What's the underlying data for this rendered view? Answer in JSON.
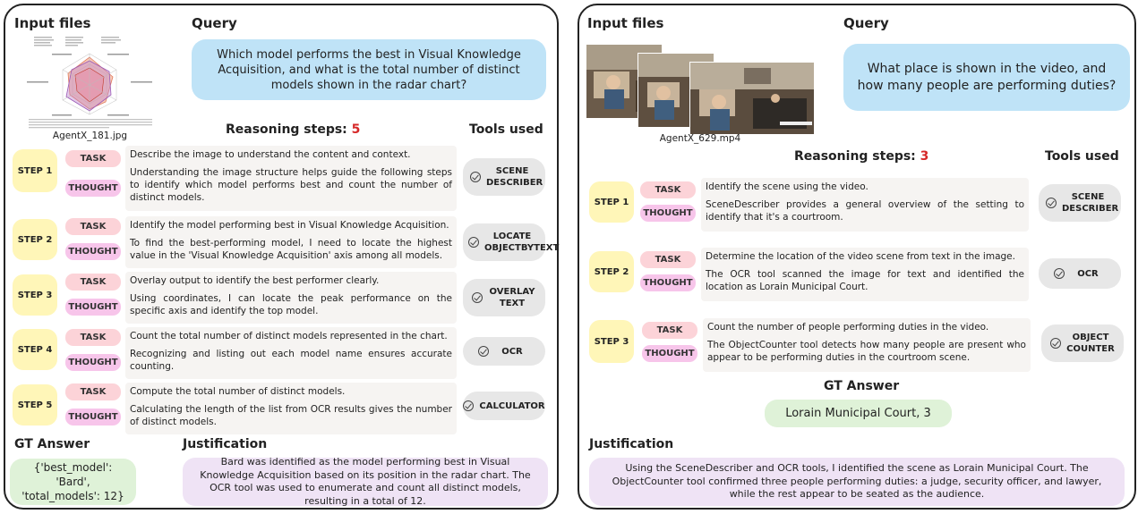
{
  "left": {
    "input_files_header": "Input files",
    "query_header": "Query",
    "query_text": "Which model performs the best in Visual Knowledge Acquisition, and what is the total number of distinct models shown in the radar chart?",
    "file_caption": "AgentX_181.jpg",
    "reasoning_label": "Reasoning steps:",
    "reasoning_count": "5",
    "tools_header": "Tools used",
    "steps": [
      {
        "badge": "STEP 1",
        "task_label": "TASK",
        "thought_label": "THOUGHT",
        "task": "Describe the image to understand the content and context.",
        "thought": "Understanding the image structure helps guide the following steps to identify which model performs best and count the number of distinct models.",
        "tool": "SCENE DESCRIBER"
      },
      {
        "badge": "STEP 2",
        "task_label": "TASK",
        "thought_label": "THOUGHT",
        "task": "Identify the model performing best in Visual Knowledge Acquisition.",
        "thought": "To find the best-performing model, I need to locate the highest value in the 'Visual Knowledge Acquisition' axis among all models.",
        "tool": "LOCATE OBJECTBYTEXT"
      },
      {
        "badge": "STEP 3",
        "task_label": "TASK",
        "thought_label": "THOUGHT",
        "task": "Overlay output to identify the best performer clearly.",
        "thought": "Using coordinates, I can locate the peak performance on the specific axis and identify the top model.",
        "tool": "OVERLAY TEXT"
      },
      {
        "badge": "STEP 4",
        "task_label": "TASK",
        "thought_label": "THOUGHT",
        "task": "Count the total number of distinct models represented in the chart.",
        "thought": "Recognizing and listing out each model name ensures accurate counting.",
        "tool": "OCR"
      },
      {
        "badge": "STEP 5",
        "task_label": "TASK",
        "thought_label": "THOUGHT",
        "task": "Compute the total number of distinct models.",
        "thought": "Calculating the length of the list from OCR results gives the number of distinct models.",
        "tool": "CALCULATOR"
      }
    ],
    "gt_header": "GT Answer",
    "gt_text": "{'best_model': 'Bard', 'total_models': 12}",
    "justification_header": "Justification",
    "justification_text": "Bard was identified as the model performing best in Visual Knowledge Acquisition based on its position in the radar chart. The OCR tool was used to enumerate and count all distinct models, resulting in a total of 12."
  },
  "right": {
    "input_files_header": "Input files",
    "query_header": "Query",
    "query_text": "What place is shown in the video, and how many people are performing duties?",
    "file_caption": "AgentX_629.mp4",
    "reasoning_label": "Reasoning steps:",
    "reasoning_count": "3",
    "tools_header": "Tools used",
    "steps": [
      {
        "badge": "STEP 1",
        "task_label": "TASK",
        "thought_label": "THOUGHT",
        "task": "Identify the scene using the video.",
        "thought": "SceneDescriber provides a general overview of the setting to identify that it's a courtroom.",
        "tool": "SCENE DESCRIBER"
      },
      {
        "badge": "STEP 2",
        "task_label": "TASK",
        "thought_label": "THOUGHT",
        "task": "Determine the location of the video scene from text in the image.",
        "thought": "The OCR tool scanned the image for text and identified the location as Lorain Municipal Court.",
        "tool": "OCR"
      },
      {
        "badge": "STEP 3",
        "task_label": "TASK",
        "thought_label": "THOUGHT",
        "task": "Count the number of people performing duties in the video.",
        "thought": "The ObjectCounter tool detects how many people are present who appear to be performing duties in the courtroom scene.",
        "tool": "OBJECT COUNTER"
      }
    ],
    "gt_header": "GT Answer",
    "gt_text": "Lorain Municipal Court, 3",
    "justification_header": "Justification",
    "justification_text": "Using the SceneDescriber and OCR tools, I identified the scene as Lorain Municipal Court. The ObjectCounter tool confirmed three people performing duties: a judge, security officer, and lawyer, while the rest appear to be seated as the audience."
  },
  "colors": {
    "query_bg": "#bfe3f7",
    "step_badge": "#fff6b8",
    "task_pill": "#fcd3d8",
    "thought_pill": "#f7c5ea",
    "gt_bg": "#dff2d8",
    "justification_bg": "#efe3f5",
    "accent_red": "#d62828"
  }
}
